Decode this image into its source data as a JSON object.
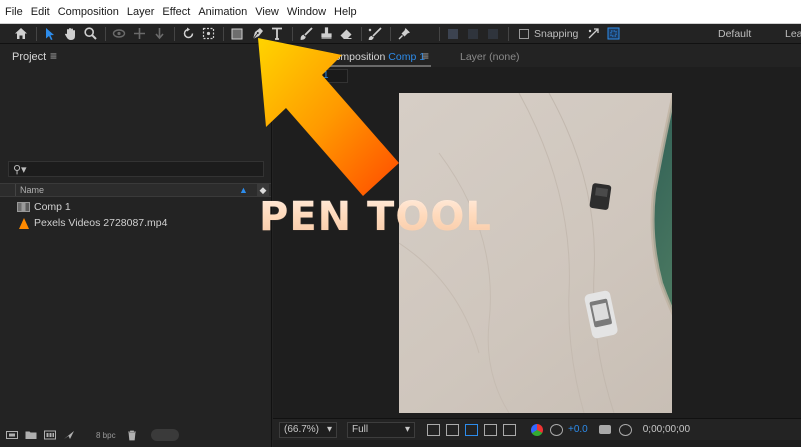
{
  "menu": {
    "items": [
      "File",
      "Edit",
      "Composition",
      "Layer",
      "Effect",
      "Animation",
      "View",
      "Window",
      "Help"
    ]
  },
  "toolbar": {
    "tools": [
      {
        "name": "home-icon"
      },
      {
        "name": "selection-tool-icon",
        "active": true
      },
      {
        "name": "hand-tool-icon"
      },
      {
        "name": "zoom-tool-icon"
      },
      {
        "name": "orbit-tool-icon"
      },
      {
        "name": "pan-tool-icon"
      },
      {
        "name": "dolly-tool-icon"
      },
      {
        "name": "rotation-tool-icon"
      },
      {
        "name": "anchor-point-tool-icon"
      },
      {
        "name": "rectangle-tool-icon"
      },
      {
        "name": "pen-tool-icon"
      },
      {
        "name": "type-tool-icon"
      },
      {
        "name": "brush-tool-icon"
      },
      {
        "name": "clone-stamp-tool-icon"
      },
      {
        "name": "eraser-tool-icon"
      },
      {
        "name": "roto-brush-tool-icon"
      },
      {
        "name": "puppet-pin-tool-icon"
      }
    ],
    "snapping_label": "Snapping",
    "workspace_default": "Default",
    "workspace_learn": "Lea"
  },
  "project": {
    "tab_label": "Project",
    "menu_glyph": "≡",
    "search_glyph": "⚲▾",
    "column_name": "Name",
    "items": [
      {
        "label": "Comp 1",
        "kind": "composition"
      },
      {
        "label": "Pexels Videos 2728087.mp4",
        "kind": "footage"
      }
    ],
    "bit_depth": "8 bpc"
  },
  "composition": {
    "tab_prefix": "Composition",
    "tab_name": "Comp 1",
    "menu_glyph": "≡",
    "layer_tab": "Layer (none)",
    "sub_tab": "1",
    "zoom": "(66.7%)",
    "resolution": "Full",
    "exposure": "+0.0",
    "timecode": "0;00;00;00"
  },
  "annotation": {
    "caption": "PEN TOOL",
    "arrow_colors": [
      "#ffd400",
      "#ff9a00",
      "#ff4a00"
    ]
  }
}
